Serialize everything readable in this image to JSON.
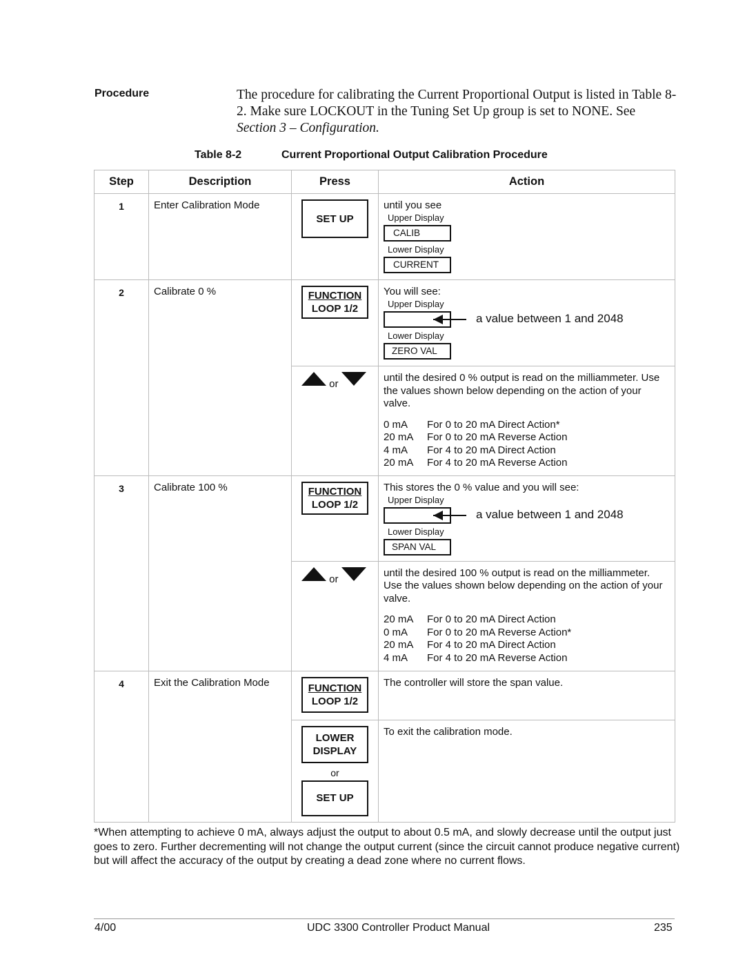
{
  "procedure_label": "Procedure",
  "intro": {
    "t1": "The procedure for calibrating the Current Proportional Output is listed in Table 8-2. Make sure LOCKOUT in the Tuning Set Up group is set to NONE. See ",
    "t2": "Section 3 – Configuration."
  },
  "caption": {
    "number": "Table 8-2",
    "title": "Current Proportional Output Calibration Procedure"
  },
  "headers": {
    "step": "Step",
    "description": "Description",
    "press": "Press",
    "action": "Action"
  },
  "keys": {
    "setup": "SET UP",
    "function": "FUNCTION",
    "loop": "LOOP 1/2",
    "lower": "LOWER",
    "display": "DISPLAY",
    "or": "or"
  },
  "labels": {
    "upper": "Upper Display",
    "lower": "Lower Display",
    "value": "a value between 1 and 2048"
  },
  "rows": [
    {
      "step": "1",
      "description": "Enter Calibration Mode",
      "action_intro": "until you see",
      "upper": "CALIB",
      "lower": "CURRENT"
    },
    {
      "step": "2",
      "description": "Calibrate 0 %",
      "action_intro": "You will see:",
      "lower": "ZERO VAL",
      "adjust": "until the desired 0 % output is read on the milliammeter. Use the values shown below depending on the action of your valve.",
      "values": [
        [
          "0 mA",
          "For 0 to 20 mA Direct Action*"
        ],
        [
          "20 mA",
          "For 0 to 20 mA Reverse Action"
        ],
        [
          "4 mA",
          "For 4 to 20 mA Direct Action"
        ],
        [
          "20 mA",
          "For 4 to 20 mA Reverse Action"
        ]
      ]
    },
    {
      "step": "3",
      "description": "Calibrate 100 %",
      "action_intro": "This stores the 0 % value and you will see:",
      "lower": "SPAN VAL",
      "adjust": "until the desired 100 % output is read on the milliammeter. Use the values shown below depending on the action of your valve.",
      "values": [
        [
          "20 mA",
          "For 0 to 20 mA Direct Action"
        ],
        [
          "0 mA",
          "For 0 to 20 mA Reverse Action*"
        ],
        [
          "20 mA",
          "For 4 to 20 mA Direct Action"
        ],
        [
          "4 mA",
          "For 4 to 20 mA Reverse Action"
        ]
      ]
    },
    {
      "step": "4",
      "description": "Exit the Calibration Mode",
      "action1": "The controller will store the span value.",
      "action2": "To exit the calibration mode."
    }
  ],
  "footnote": "*When attempting to achieve 0 mA, always adjust the output to about 0.5 mA, and slowly decrease until the output just goes to zero. Further decrementing will not change the output current (since the circuit cannot produce negative current) but will affect the accuracy of the output by creating a dead zone where no current flows.",
  "footer": {
    "date": "4/00",
    "title": "UDC 3300 Controller Product Manual",
    "page": "235"
  }
}
